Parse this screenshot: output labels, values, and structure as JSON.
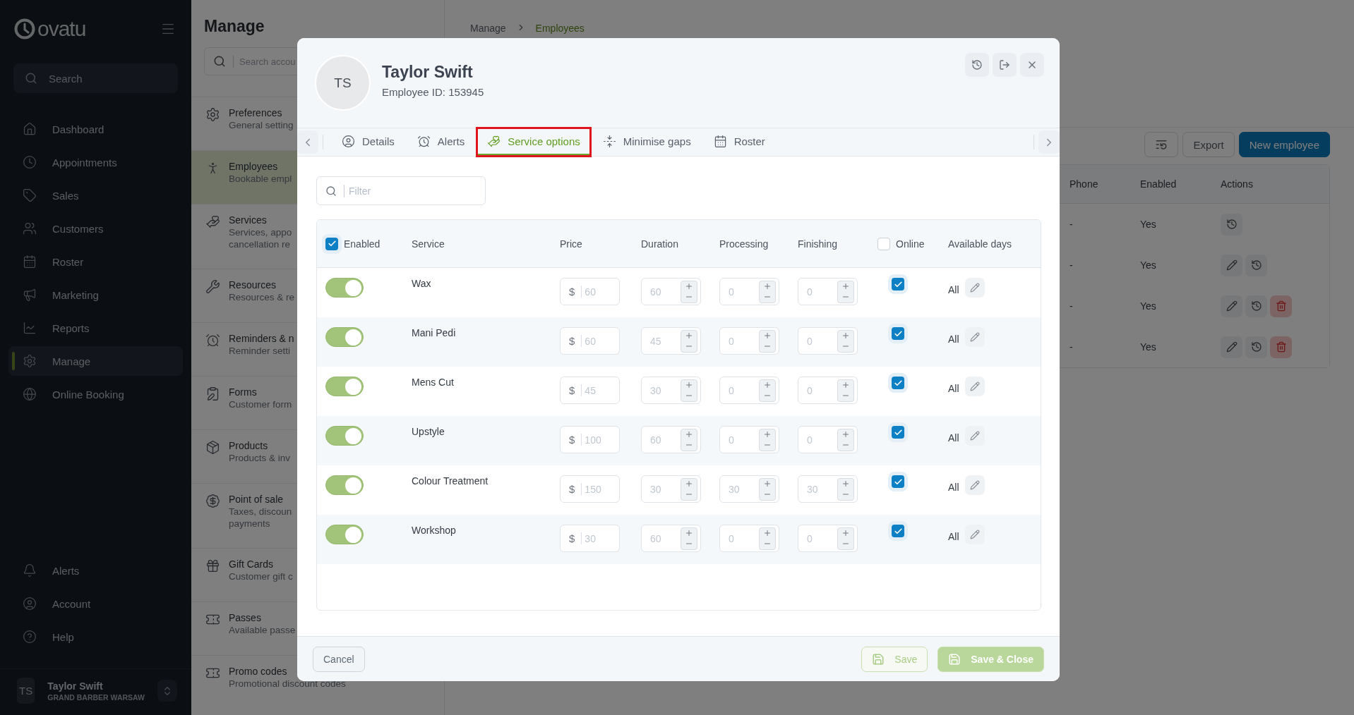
{
  "sidebar": {
    "logo": "ovatu",
    "search_placeholder": "Search",
    "items": [
      {
        "label": "Dashboard",
        "kind": "home",
        "selected": false
      },
      {
        "label": "Appointments",
        "kind": "clock",
        "selected": false
      },
      {
        "label": "Sales",
        "kind": "tag",
        "selected": false
      },
      {
        "label": "Customers",
        "kind": "users",
        "selected": false
      },
      {
        "label": "Roster",
        "kind": "calendar",
        "selected": false
      },
      {
        "label": "Marketing",
        "kind": "megaphone",
        "selected": false
      },
      {
        "label": "Reports",
        "kind": "chart",
        "selected": false
      },
      {
        "label": "Manage",
        "kind": "gears",
        "selected": true
      },
      {
        "label": "Online Booking",
        "kind": "globe",
        "selected": false
      }
    ],
    "bottom_items": [
      {
        "label": "Alerts",
        "kind": "bell"
      },
      {
        "label": "Account",
        "kind": "user"
      },
      {
        "label": "Help",
        "kind": "help"
      }
    ],
    "user": {
      "initials": "TS",
      "name": "Taylor Swift",
      "location": "GRAND BARBER WARSAW"
    }
  },
  "manage_panel": {
    "title": "Manage",
    "search_placeholder": "Search accou",
    "items": [
      {
        "title": "Preferences",
        "subtitle": "General setting",
        "kind": "gears",
        "selected": false
      },
      {
        "title": "Employees",
        "subtitle": "Bookable empl",
        "kind": "person",
        "selected": true
      },
      {
        "title": "Services",
        "subtitle": "Services, appo\ncancellation re",
        "kind": "service",
        "selected": false
      },
      {
        "title": "Resources",
        "subtitle": "Resources & re",
        "kind": "tools",
        "selected": false
      },
      {
        "title": "Reminders & n",
        "subtitle": "Reminder setti",
        "kind": "alarm",
        "selected": false
      },
      {
        "title": "Forms",
        "subtitle": "Customer form",
        "kind": "form",
        "selected": false
      },
      {
        "title": "Products",
        "subtitle": "Products & inv",
        "kind": "box",
        "selected": false
      },
      {
        "title": "Point of sale",
        "subtitle": "Taxes, discoun\npayments",
        "kind": "money",
        "selected": false
      },
      {
        "title": "Gift Cards",
        "subtitle": "Customer gift c",
        "kind": "gift",
        "selected": false
      },
      {
        "title": "Passes",
        "subtitle": "Available passe",
        "kind": "ticket",
        "selected": false
      },
      {
        "title": "Promo codes",
        "subtitle": "Promotional discount codes",
        "kind": "ticket",
        "selected": false
      }
    ]
  },
  "breadcrumb": [
    "Manage",
    "Employees"
  ],
  "toolbar": {
    "export": "Export",
    "new": "New employee"
  },
  "employees_table": {
    "columns": [
      "Phone",
      "Enabled",
      "Actions"
    ],
    "rows": [
      {
        "phone": "-",
        "enabled": "Yes",
        "can_edit": false,
        "can_restore": true,
        "can_delete": false
      },
      {
        "phone": "-",
        "enabled": "Yes",
        "can_edit": true,
        "can_restore": true,
        "can_delete": false
      },
      {
        "phone": "-",
        "enabled": "Yes",
        "can_edit": true,
        "can_restore": true,
        "can_delete": true
      },
      {
        "phone": "-",
        "enabled": "Yes",
        "can_edit": true,
        "can_restore": true,
        "can_delete": true
      }
    ]
  },
  "modal": {
    "avatar": "TS",
    "name": "Taylor Swift",
    "employee_id": "Employee ID: 153945",
    "tabs": [
      {
        "label": "Details",
        "kind": "user",
        "selected": false,
        "highlighted": false
      },
      {
        "label": "Alerts",
        "kind": "alarm",
        "selected": false,
        "highlighted": false
      },
      {
        "label": "Service options",
        "kind": "service",
        "selected": true,
        "highlighted": true
      },
      {
        "label": "Minimise gaps",
        "kind": "gaps",
        "selected": false,
        "highlighted": false
      },
      {
        "label": "Roster",
        "kind": "calendar",
        "selected": false,
        "highlighted": false
      }
    ],
    "filter_placeholder": "Filter",
    "columns": {
      "enabled": "Enabled",
      "service": "Service",
      "price": "Price",
      "duration": "Duration",
      "processing": "Processing",
      "finishing": "Finishing",
      "online": "Online",
      "days": "Available days"
    },
    "enabled_all_checked": true,
    "online_all_checked": false,
    "rows": [
      {
        "service": "Wax",
        "enabled": true,
        "currency": "$",
        "price": "60",
        "duration": "60",
        "processing": "0",
        "finishing": "0",
        "online": true,
        "days": "All"
      },
      {
        "service": "Mani Pedi",
        "enabled": true,
        "currency": "$",
        "price": "60",
        "duration": "45",
        "processing": "0",
        "finishing": "0",
        "online": true,
        "days": "All"
      },
      {
        "service": "Mens Cut",
        "enabled": true,
        "currency": "$",
        "price": "45",
        "duration": "30",
        "processing": "0",
        "finishing": "0",
        "online": true,
        "days": "All"
      },
      {
        "service": "Upstyle",
        "enabled": true,
        "currency": "$",
        "price": "100",
        "duration": "60",
        "processing": "0",
        "finishing": "0",
        "online": true,
        "days": "All"
      },
      {
        "service": "Colour Treatment",
        "enabled": true,
        "currency": "$",
        "price": "150",
        "duration": "30",
        "processing": "30",
        "finishing": "30",
        "online": true,
        "days": "All"
      },
      {
        "service": "Workshop",
        "enabled": true,
        "currency": "$",
        "price": "30",
        "duration": "60",
        "processing": "0",
        "finishing": "0",
        "online": true,
        "days": "All"
      }
    ],
    "footer": {
      "cancel": "Cancel",
      "save": "Save",
      "save_close": "Save & Close"
    }
  }
}
